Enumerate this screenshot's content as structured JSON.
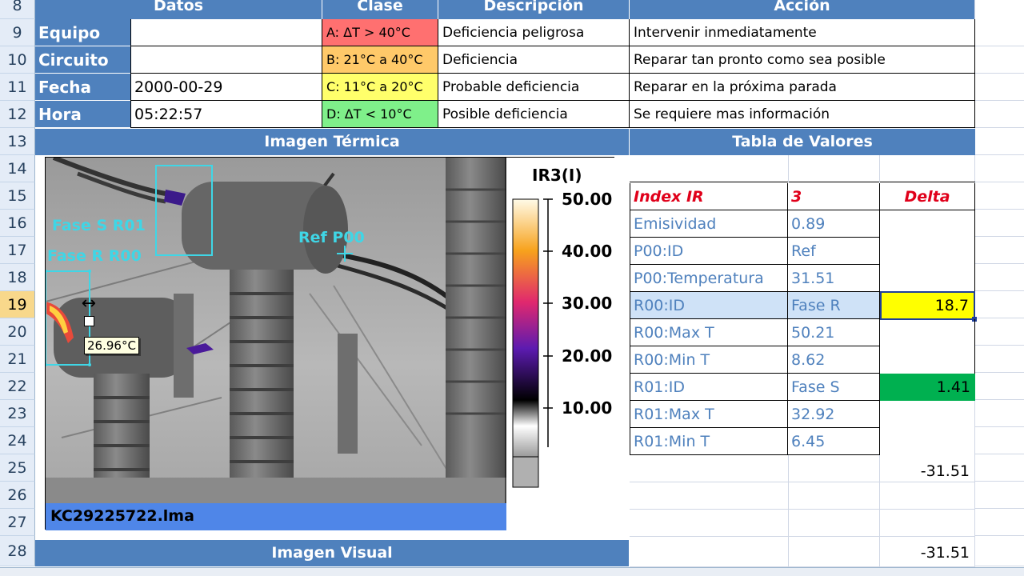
{
  "rows": [
    "8",
    "9",
    "10",
    "11",
    "12",
    "13",
    "14",
    "15",
    "16",
    "17",
    "18",
    "19",
    "20",
    "21",
    "22",
    "23",
    "24",
    "25",
    "26",
    "27",
    "28"
  ],
  "headers": {
    "datos": "Datos",
    "clase": "Clase",
    "descripcion": "Descripción",
    "accion": "Acción",
    "imagen_termica": "Imagen Térmica",
    "tabla_valores": "Tabla de Valores",
    "imagen_visual": "Imagen Visual"
  },
  "fields": [
    {
      "label": "Equipo",
      "value": ""
    },
    {
      "label": "Circuito",
      "value": ""
    },
    {
      "label": "Fecha",
      "value": "2000-00-29"
    },
    {
      "label": "Hora",
      "value": "05:22:57"
    }
  ],
  "classes": [
    {
      "clase": "A: ΔT > 40°C",
      "desc": "Deficiencia peligrosa",
      "accion": "Intervenir inmediatamente",
      "color": "#ff7070"
    },
    {
      "clase": "B: 21°C a 40°C",
      "desc": "Deficiencia",
      "accion": "Reparar tan pronto como sea posible",
      "color": "#ffc969"
    },
    {
      "clase": "C: 11°C a 20°C",
      "desc": "Probable deficiencia",
      "accion": "Reparar en la próxima parada",
      "color": "#ffff6b"
    },
    {
      "clase": "D: ΔT  < 10°C",
      "desc": "Posible deficiencia",
      "accion": "Se requiere mas información",
      "color": "#7ff08a"
    }
  ],
  "thermal": {
    "scale_title": "IR3(I)",
    "scale_ticks": [
      "50.00",
      "40.00",
      "30.00",
      "20.00",
      "10.00"
    ],
    "label_fase_s": "Fase S R01",
    "label_fase_r": "Fase R R00",
    "label_ref": "Ref P00",
    "tooltip": "26.96°C",
    "filename": "KC29225722.lma"
  },
  "table": {
    "head": [
      "Index IR",
      "3",
      "Delta"
    ],
    "rows": [
      [
        "Emisividad",
        "0.89",
        ""
      ],
      [
        "P00:ID",
        "Ref",
        ""
      ],
      [
        "P00:Temperatura",
        "31.51",
        ""
      ],
      [
        "R00:ID",
        "Fase R",
        "18.7"
      ],
      [
        "R00:Max T",
        "50.21",
        ""
      ],
      [
        "R00:Min T",
        "8.62",
        ""
      ],
      [
        "R01:ID",
        "Fase S",
        "1.41"
      ],
      [
        "R01:Max T",
        "32.92",
        ""
      ],
      [
        "R01:Min T",
        "6.45",
        ""
      ]
    ],
    "extra_25": "-31.51",
    "extra_28": "-31.51"
  },
  "colors": {
    "header_blue": "#4f81bd",
    "highlight_yellow": "#ffff00",
    "highlight_green": "#00b050",
    "selection_blue": "#cfe2f7"
  }
}
